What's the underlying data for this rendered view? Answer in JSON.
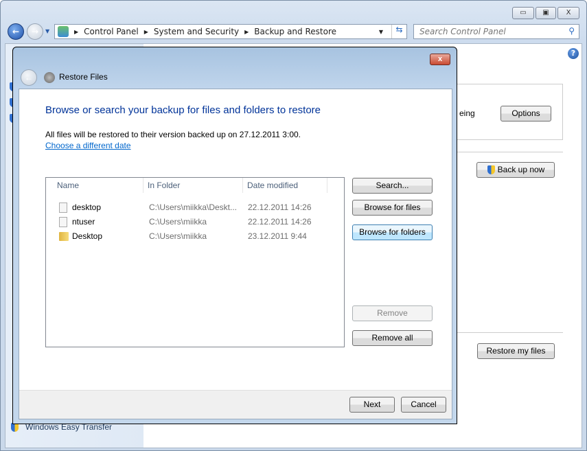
{
  "window": {
    "minimize": "▭",
    "maximize": "▣",
    "close": "X"
  },
  "address": {
    "crumbs": [
      "Control Panel",
      "System and Security",
      "Backup and Restore"
    ],
    "search_placeholder": "Search Control Panel"
  },
  "background": {
    "options_label": "Options",
    "partial_text": "eing",
    "backup_now_label": "Back up now",
    "restore_my_files_label": "Restore my files",
    "easy_transfer": "Windows Easy Transfer"
  },
  "dialog": {
    "title": "Restore Files",
    "close": "x",
    "heading": "Browse or search your backup for files and folders to restore",
    "info": "All files will be restored to their version backed up on 27.12.2011 3:00.",
    "choose_date_link": "Choose a different date",
    "columns": [
      "Name",
      "In Folder",
      "Date modified"
    ],
    "rows": [
      {
        "name": "desktop",
        "folder": "C:\\Users\\miikka\\Deskt...",
        "date": "22.12.2011 14:26",
        "icon": "file-icon"
      },
      {
        "name": "ntuser",
        "folder": "C:\\Users\\miikka",
        "date": "22.12.2011 14:26",
        "icon": "file-icon"
      },
      {
        "name": "Desktop",
        "folder": "C:\\Users\\miikka",
        "date": "23.12.2011 9:44",
        "icon": "folder-icon"
      }
    ],
    "buttons": {
      "search": "Search...",
      "browse_files": "Browse for files",
      "browse_folders": "Browse for folders",
      "remove": "Remove",
      "remove_all": "Remove all",
      "next": "Next",
      "cancel": "Cancel"
    }
  }
}
